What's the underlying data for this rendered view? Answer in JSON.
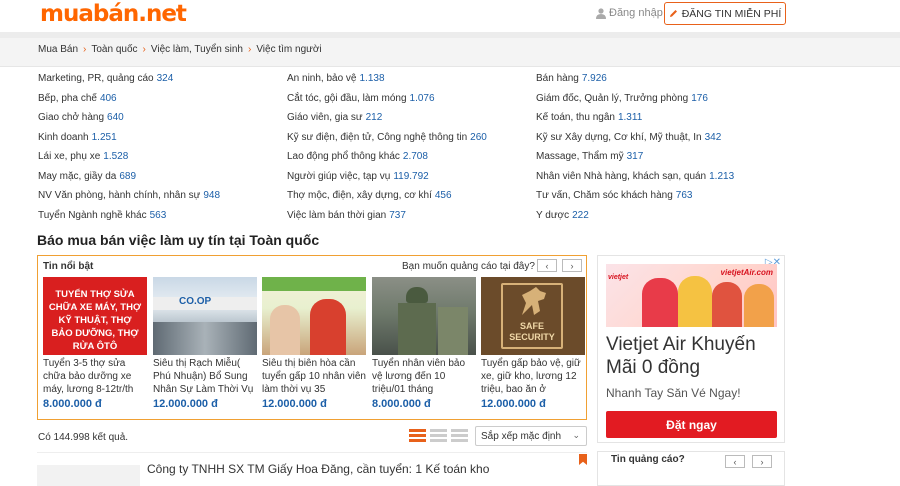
{
  "header": {
    "logo_main": "muabán",
    "logo_suffix": ".net",
    "login_label": "Đăng nhập",
    "post_button": "ĐĂNG TIN MIỄN PHÍ"
  },
  "breadcrumb": [
    "Mua Bán",
    "Toàn quốc",
    "Việc làm, Tuyển sinh",
    "Việc tìm người"
  ],
  "categories": [
    [
      {
        "name": "Marketing, PR, quảng cáo",
        "count": "324"
      },
      {
        "name": "Bếp, pha chế",
        "count": "406"
      },
      {
        "name": "Giao chở hàng",
        "count": "640"
      },
      {
        "name": "Kinh doanh",
        "count": "1.251"
      },
      {
        "name": "Lái xe, phụ xe",
        "count": "1.528"
      },
      {
        "name": "May mặc, giầy da",
        "count": "689"
      },
      {
        "name": "NV Văn phòng, hành chính, nhân sự",
        "count": "948"
      },
      {
        "name": "Tuyển Ngành nghề khác",
        "count": "563"
      }
    ],
    [
      {
        "name": "An ninh, bảo vệ",
        "count": "1.138"
      },
      {
        "name": "Cắt tóc, gội đầu, làm móng",
        "count": "1.076"
      },
      {
        "name": "Giáo viên, gia sư",
        "count": "212"
      },
      {
        "name": "Kỹ sư điện, điện tử, Công nghệ thông tin",
        "count": "260"
      },
      {
        "name": "Lao động phổ thông khác",
        "count": "2.708"
      },
      {
        "name": "Người giúp việc, tạp vụ",
        "count": "119.792"
      },
      {
        "name": "Thợ mộc, điện, xây dựng, cơ khí",
        "count": "456"
      },
      {
        "name": "Việc làm bán thời gian",
        "count": "737"
      }
    ],
    [
      {
        "name": "Bán hàng",
        "count": "7.926"
      },
      {
        "name": "Giám đốc, Quản lý, Trưởng phòng",
        "count": "176"
      },
      {
        "name": "Kế toán, thu ngân",
        "count": "1.311"
      },
      {
        "name": "Kỹ sư Xây dựng, Cơ khí, Mỹ thuật, In",
        "count": "342"
      },
      {
        "name": "Massage, Thẩm mỹ",
        "count": "317"
      },
      {
        "name": "Nhân viên Nhà hàng, khách sạn, quán",
        "count": "1.213"
      },
      {
        "name": "Tư vấn, Chăm sóc khách hàng",
        "count": "763"
      },
      {
        "name": "Y dược",
        "count": "222"
      }
    ]
  ],
  "section_title": "Báo mua bán việc làm uy tín tại Toàn quốc",
  "featured": {
    "label": "Tin nổi bật",
    "ask": "Bạn muốn quảng cáo tại đây?",
    "prev_icon": "chevron-left-icon",
    "next_icon": "chevron-right-icon",
    "cards": [
      {
        "title": "Tuyển 3-5 thợ sửa chữa bảo dưỡng xe máy, lương 8-12tr/th",
        "price": "8.000.000 đ",
        "img_text": "TUYỂN THỢ SỬA CHỮA XE MÁY, THỢ KỸ THUẬT, THỢ BẢO DƯỠNG, THỢ RỬA ÔTÔ"
      },
      {
        "title": "Siêu thị Rạch Miễu( Phú Nhuận) Bổ Sung Nhân Sự Làm Thời Vụ",
        "price": "12.000.000 đ",
        "img_text": "CO.OP"
      },
      {
        "title": "Siêu thị biên hòa cần tuyển gấp 10 nhân viên làm thời vụ 35",
        "price": "12.000.000 đ",
        "img_text": ""
      },
      {
        "title": "Tuyển nhân viên bảo vệ lương đến 10 triệu/01 tháng",
        "price": "8.000.000 đ",
        "img_text": ""
      },
      {
        "title": "Tuyển gấp bảo vệ, giữ xe, giữ kho, lương 12 triệu, bao ăn ở",
        "price": "12.000.000 đ",
        "img_text": "SAFE SECURITY"
      }
    ]
  },
  "results": {
    "count_text": "Có 144.998 kết quả.",
    "sort_label": "Sắp xếp mặc định"
  },
  "listing": {
    "title": "Công ty TNHH SX TM Giấy Hoa Đăng, cần tuyển: 1 Kế toán kho"
  },
  "ad": {
    "brand": "vietjetAir.com",
    "title": "Vietjet Air Khuyến Mãi 0 đồng",
    "subtitle": "Nhanh Tay Săn Vé Ngay!",
    "cta": "Đặt ngay",
    "brand_color": "#e21b22"
  },
  "ad2": {
    "ask": "Tin quảng cáo?"
  },
  "colors": {
    "brand_orange": "#ff6600",
    "count_blue": "#1c5fa8",
    "price_blue": "#1c5fa8"
  }
}
